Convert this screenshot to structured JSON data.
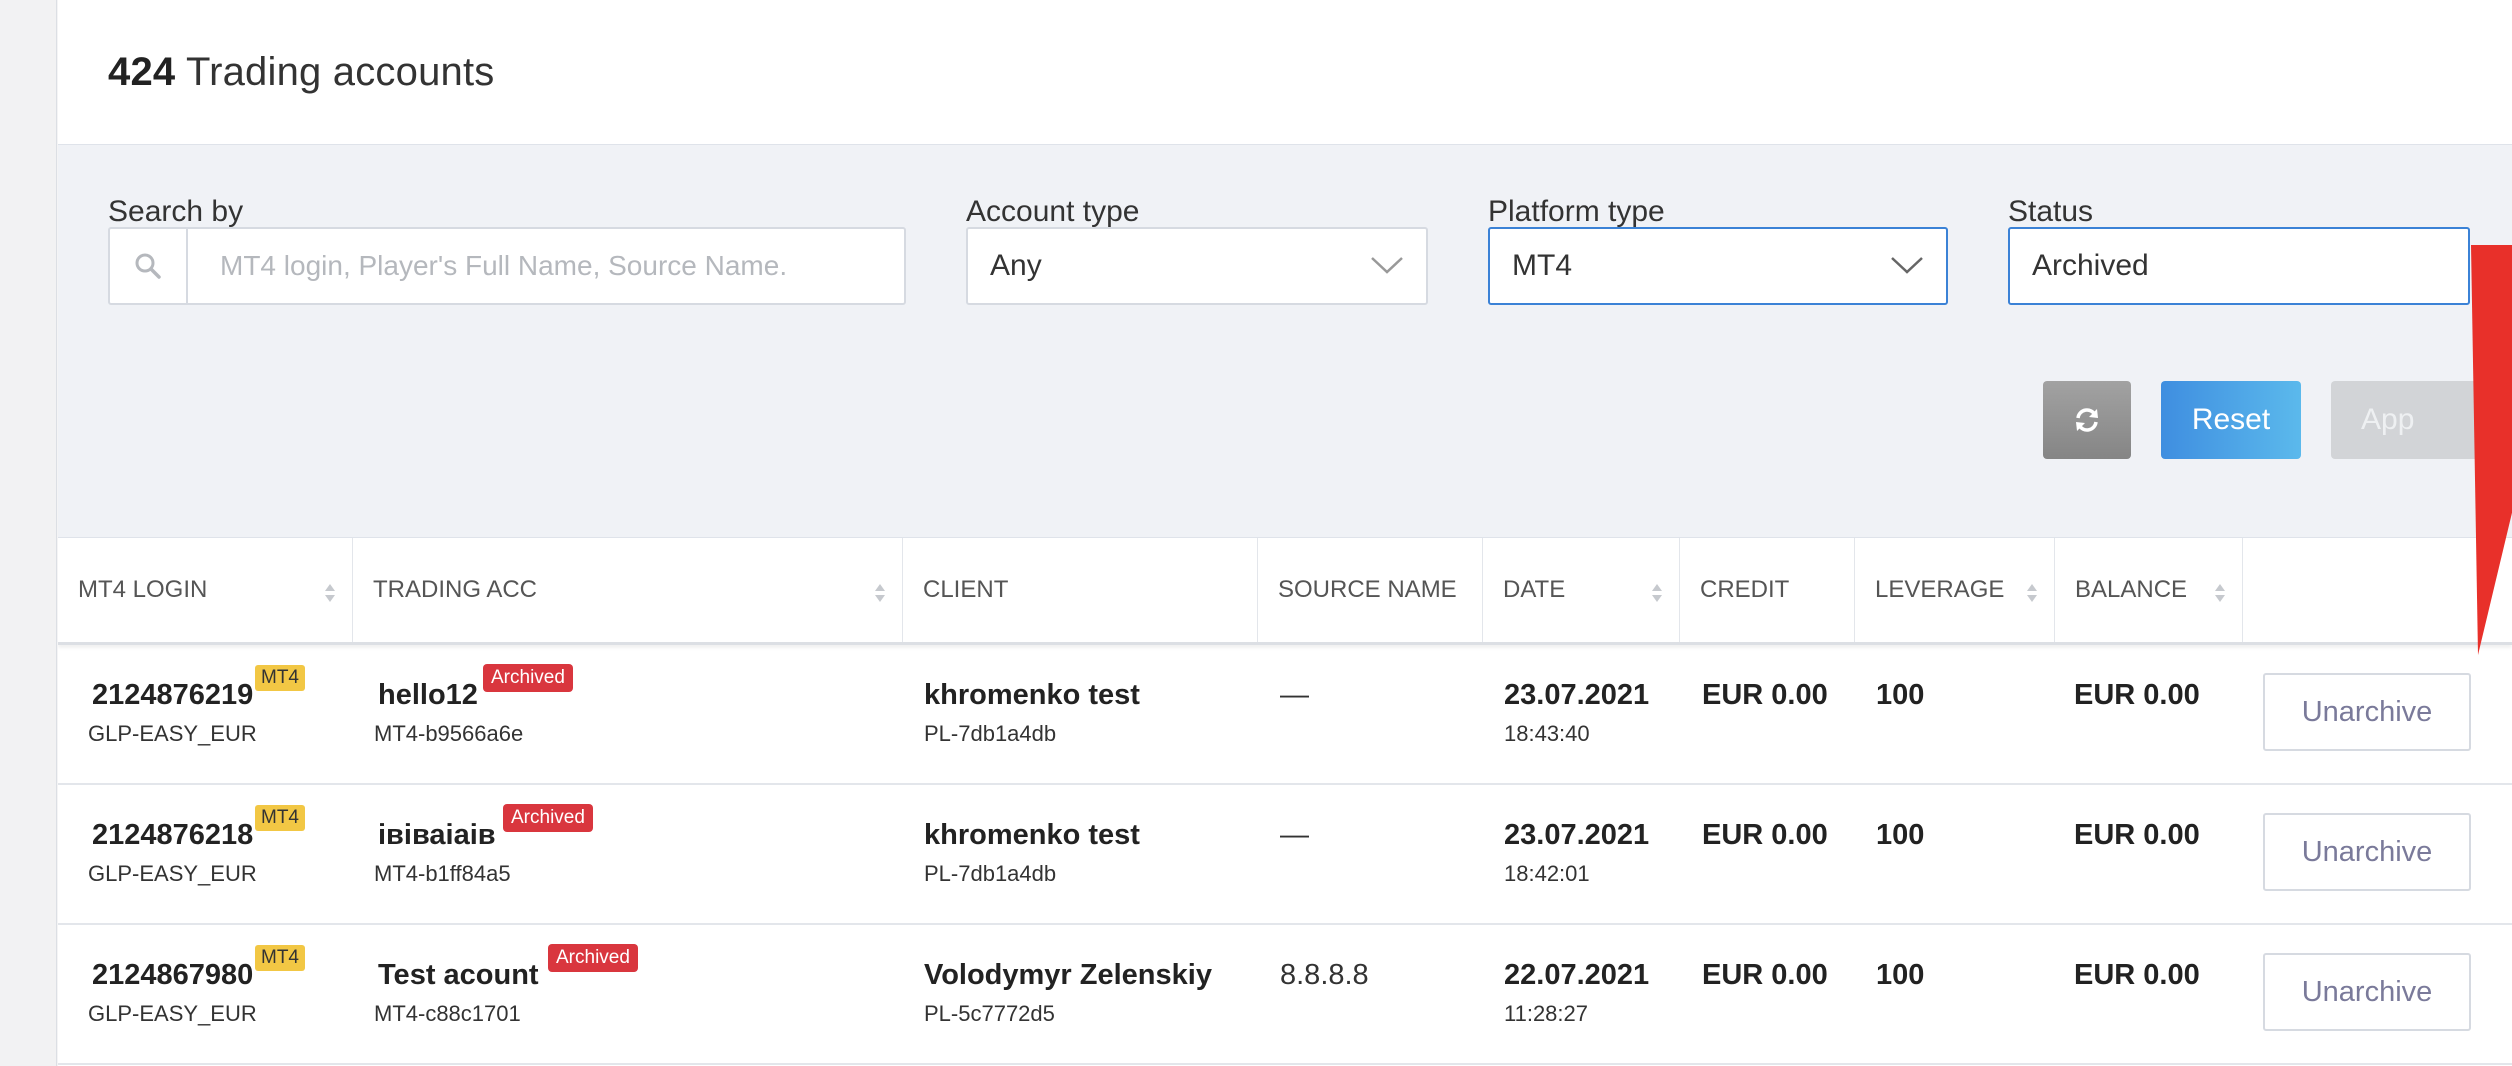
{
  "header": {
    "count": "424",
    "title": "Trading accounts"
  },
  "filters": {
    "search": {
      "label": "Search by",
      "placeholder": "MT4 login, Player's Full Name, Source Name."
    },
    "account_type": {
      "label": "Account type",
      "value": "Any"
    },
    "platform_type": {
      "label": "Platform type",
      "value": "MT4"
    },
    "status": {
      "label": "Status",
      "value": "Archived"
    },
    "buttons": {
      "reset": "Reset",
      "apply": "App"
    }
  },
  "table": {
    "columns": [
      "MT4 LOGIN",
      "TRADING ACC",
      "CLIENT",
      "SOURCE NAME",
      "DATE",
      "CREDIT",
      "LEVERAGE",
      "BALANCE"
    ],
    "rows": [
      {
        "login": "2124876219",
        "platform_badge": "MT4",
        "group": "GLP-EASY_EUR",
        "acc_name": "hello12",
        "status_badge": "Archived",
        "acc_id": "MT4-b9566a6e",
        "client_name": "khromenko test",
        "client_id": "PL-7db1a4db",
        "source": "—",
        "date": "23.07.2021",
        "time": "18:43:40",
        "credit": "EUR 0.00",
        "leverage": "100",
        "balance": "EUR 0.00",
        "action": "Unarchive"
      },
      {
        "login": "2124876218",
        "platform_badge": "MT4",
        "group": "GLP-EASY_EUR",
        "acc_name": "івіваіаів",
        "status_badge": "Archived",
        "acc_id": "MT4-b1ff84a5",
        "client_name": "khromenko test",
        "client_id": "PL-7db1a4db",
        "source": "—",
        "date": "23.07.2021",
        "time": "18:42:01",
        "credit": "EUR 0.00",
        "leverage": "100",
        "balance": "EUR 0.00",
        "action": "Unarchive"
      },
      {
        "login": "2124867980",
        "platform_badge": "MT4",
        "group": "GLP-EASY_EUR",
        "acc_name": "Test acount",
        "status_badge": "Archived",
        "acc_id": "MT4-c88c1701",
        "client_name": "Volodymyr Zelenskiy",
        "client_id": "PL-5c7772d5",
        "source": "8.8.8.8",
        "date": "22.07.2021",
        "time": "11:28:27",
        "credit": "EUR 0.00",
        "leverage": "100",
        "balance": "EUR 0.00",
        "action": "Unarchive"
      }
    ]
  },
  "colors": {
    "accent": "#3b82d6",
    "archived_badge": "#d9363e",
    "mt4_badge": "#f2c744",
    "annotation_arrow": "#e8302a"
  },
  "icons": [
    "search-icon",
    "chevron-down-icon",
    "refresh-icon",
    "sort-icon"
  ]
}
